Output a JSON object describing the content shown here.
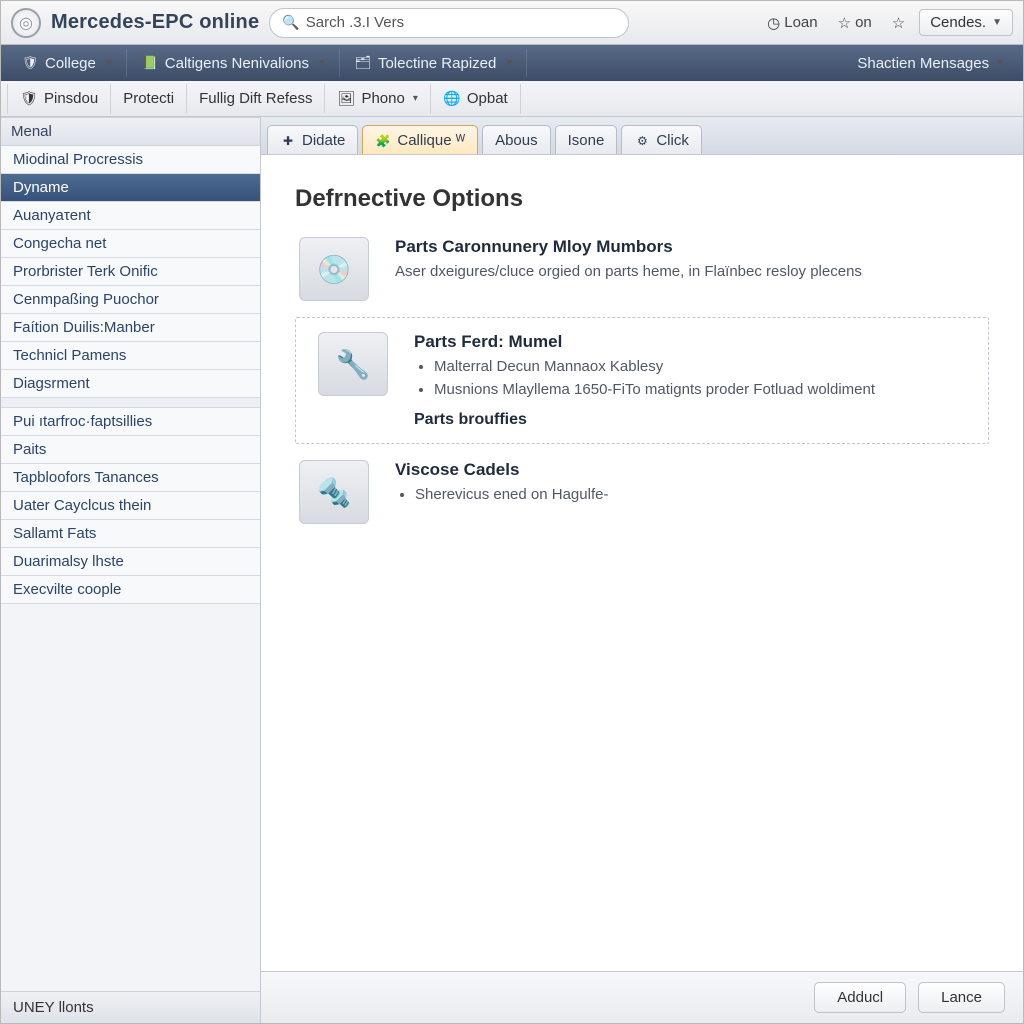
{
  "header": {
    "app_title": "Mercedes-EPC online",
    "search_value": "Sarch .3.I Vers",
    "top_right": {
      "loan": "Loan",
      "on": "on",
      "cendes": "Cendes."
    }
  },
  "menubar": {
    "items": [
      {
        "label": "College",
        "icon_name": "college-icon"
      },
      {
        "label": "Caltigens Nenivalions",
        "icon_name": "book-icon"
      },
      {
        "label": "Tolectine Rapized",
        "icon_name": "folder-icon"
      }
    ],
    "right_label": "Shactien Mensages"
  },
  "toolbar": {
    "items": [
      {
        "label": "Pinsdou",
        "icon_name": "shield-icon"
      },
      {
        "label": "Protecti",
        "icon_name": ""
      },
      {
        "label": "Fullig Dift Refess",
        "icon_name": ""
      },
      {
        "label": "Phono",
        "icon_name": "image-icon",
        "dropdown": true
      },
      {
        "label": "Opbat",
        "icon_name": "globe-icon"
      }
    ]
  },
  "sidebar": {
    "header": "Menal",
    "group1": [
      "Miodinal Procressis",
      "Dyname",
      "Auanyaτent",
      "Congecha net",
      "Prorbrister Terk Onific",
      "Cenmpaßing Puochor",
      "Faítion Duilis:Manber",
      "Technicl Pamens",
      "Diagsrment"
    ],
    "group1_selected_index": 1,
    "group2": [
      "Pui ıtarfroc·faptsillies",
      "Paits",
      "Tapbloofors Tanances",
      "Uater Cayclcus thein",
      "Sallamt Fats",
      "Duarimalsy lhste",
      "Execvilte coople"
    ],
    "footer": "UNEY llonts"
  },
  "tabs": {
    "items": [
      {
        "label": "Didate",
        "icon_name": "plus-icon",
        "active": false
      },
      {
        "label": "Callique ᵂ",
        "icon_name": "puzzle-icon",
        "active": true
      },
      {
        "label": "Abous",
        "icon_name": "",
        "active": false
      },
      {
        "label": "Isone",
        "icon_name": "",
        "active": false
      },
      {
        "label": "Click",
        "icon_name": "gear-icon",
        "active": false
      }
    ]
  },
  "content": {
    "heading": "Defrnective Options",
    "cards": [
      {
        "title": "Parts Caronnunery Mloy Mumbors",
        "desc": "Aser dxeigures/cluce orgied on parts heme, in Flaïnbec resloy plecens"
      },
      {
        "title": "Parts Ferd: Mumel",
        "bullets": [
          "Malterral Decun Mannaox Kablesy",
          "Musnions Mlayllema 1650-FiTo matignts proder Fotluad woldiment"
        ],
        "subtitle": "Parts brouffies"
      },
      {
        "title": "Viscose Cadels",
        "bullets": [
          "Sherevicus ened on Hagulfe-"
        ]
      }
    ]
  },
  "footer": {
    "btn1": "Adducl",
    "btn2": "Lance"
  }
}
